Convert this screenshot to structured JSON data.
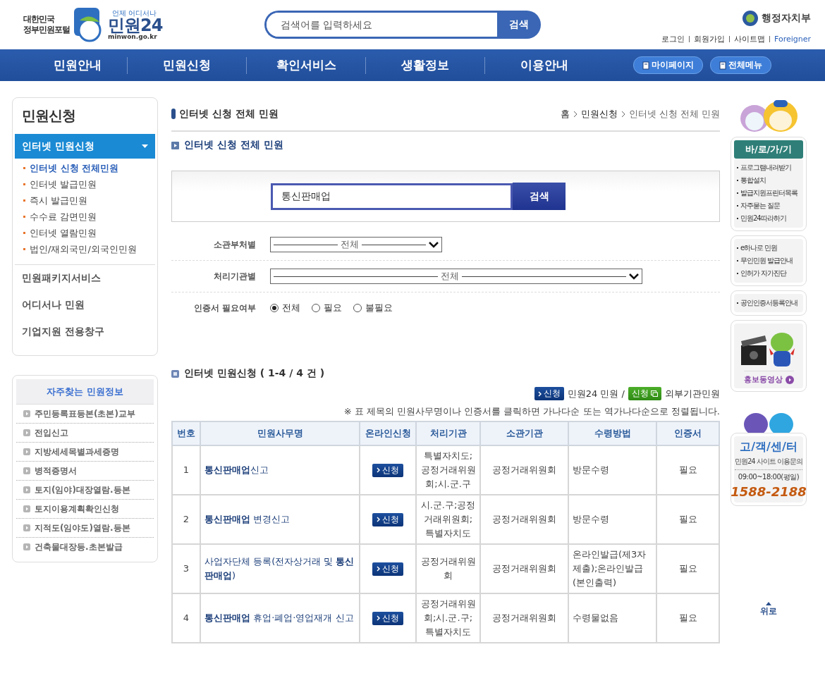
{
  "header": {
    "logo_line1": "대한민국",
    "logo_line2": "정부민원포털",
    "logo_tagline": "언제 어디서나",
    "logo_name": "민원24",
    "logo_domain": "minwon.go.kr",
    "search": {
      "placeholder": "검색어를 입력하세요",
      "button": "검색"
    },
    "ministry": "행정자치부",
    "links": [
      "로그인",
      "회원가입",
      "사이트맵",
      "Foreigner"
    ]
  },
  "nav": {
    "items": [
      "민원안내",
      "민원신청",
      "확인서비스",
      "생활정보",
      "이용안내"
    ],
    "buttons": [
      "마이페이지",
      "전체메뉴"
    ]
  },
  "sidebar": {
    "title": "민원신청",
    "sections": [
      {
        "label": "인터넷 민원신청",
        "selected": true,
        "children": [
          {
            "label": "인터넷 신청 전체민원",
            "selected": true
          },
          {
            "label": "인터넷 발급민원",
            "selected": false
          },
          {
            "label": "즉시 발급민원",
            "selected": false
          },
          {
            "label": "수수료 감면민원",
            "selected": false
          },
          {
            "label": "인터넷 열람민원",
            "selected": false
          },
          {
            "label": "법인/재외국민/외국인민원",
            "selected": false
          }
        ]
      },
      {
        "label": "민원패키지서비스",
        "selected": false
      },
      {
        "label": "어디서나 민원",
        "selected": false
      },
      {
        "label": "기업지원 전용창구",
        "selected": false
      }
    ]
  },
  "frequent": {
    "title": "자주찾는 민원정보",
    "items": [
      "주민등록표등본(초본)교부",
      "전입신고",
      "지방세세목별과세증명",
      "병적증명서",
      "토지(임야)대장열람.등본",
      "토지이용계획확인신청",
      "지적도(임야도)열람.등본",
      "건축물대장등.초본발급"
    ]
  },
  "main": {
    "page_title": "인터넷 신청 전체 민원",
    "breadcrumb": [
      "홈",
      "민원신청",
      "인터넷 신청 전체 민원"
    ],
    "section_title": "인터넷 신청 전체 민원",
    "search": {
      "value": "통신판매업",
      "button": "검색"
    },
    "filters": [
      {
        "label": "소관부처별",
        "kind": "select",
        "wide": false,
        "value": "전체"
      },
      {
        "label": "처리기관별",
        "kind": "select",
        "wide": true,
        "value": "전체"
      },
      {
        "label": "인증서 필요여부",
        "kind": "radio",
        "options": [
          {
            "label": "전체",
            "selected": true
          },
          {
            "label": "필요",
            "selected": false
          },
          {
            "label": "불필요",
            "selected": false
          }
        ]
      }
    ]
  },
  "results": {
    "title": "인터넷 민원신청 ( 1-4 / 4 건 )",
    "legend": [
      {
        "kind": "internal",
        "badge": "신청",
        "text": "민원24 민원 /"
      },
      {
        "kind": "external",
        "badge": "신청",
        "text": "외부기관민원"
      }
    ],
    "note": "※ 표 제목의 민원사무명이나 인증서를 클릭하면 가나다순 또는 역가나다순으로 정렬됩니다.",
    "columns": [
      "번호",
      "민원사무명",
      "온라인신청",
      "처리기관",
      "소관기관",
      "수령방법",
      "인증서"
    ],
    "rows": [
      {
        "no": "1",
        "name": "**통신판매업**신고",
        "apply": "신청",
        "agency": "특별자치도;공정거래위원회;시.군.구",
        "ministry": "공정거래위원회",
        "receive": "방문수령",
        "cert": "필요"
      },
      {
        "no": "2",
        "name": "**통신판매업** 변경신고",
        "apply": "신청",
        "agency": "시.군.구;공정거래위원회;특별자치도",
        "ministry": "공정거래위원회",
        "receive": "방문수령",
        "cert": "필요"
      },
      {
        "no": "3",
        "name": "사업자단체 등록(전자상거래 및 **통신판매업**)",
        "apply": "신청",
        "agency": "공정거래위원회",
        "ministry": "공정거래위원회",
        "receive": "온라인발급(제3자제출);온라인발급(본인출력)",
        "cert": "필요"
      },
      {
        "no": "4",
        "name": "**통신판매업** 휴업·폐업·영업재개 신고",
        "apply": "신청",
        "agency": "공정거래위원회;시.군.구;특별자치도",
        "ministry": "공정거래위원회",
        "receive": "수령물없음",
        "cert": "필요"
      }
    ]
  },
  "rail": {
    "shortcuts_title": "바/로/가/기",
    "shortcuts": [
      "프로그램내려받기",
      "통합설치",
      "발급지원프린터목록",
      "자주묻는 질문",
      "민원24따라하기"
    ],
    "links": [
      "e하나로 민원",
      "무인민원 발급안내",
      "인허가 자가진단"
    ],
    "links2": [
      "공인인증서등록안내"
    ],
    "video": "홍보동영상",
    "center": {
      "title": "고/객/센/터",
      "subtitle": "민원24 사이트 이용문의",
      "hours": "09:00~18:00(평일)",
      "phone": "1588-2188"
    },
    "top": "위로"
  }
}
